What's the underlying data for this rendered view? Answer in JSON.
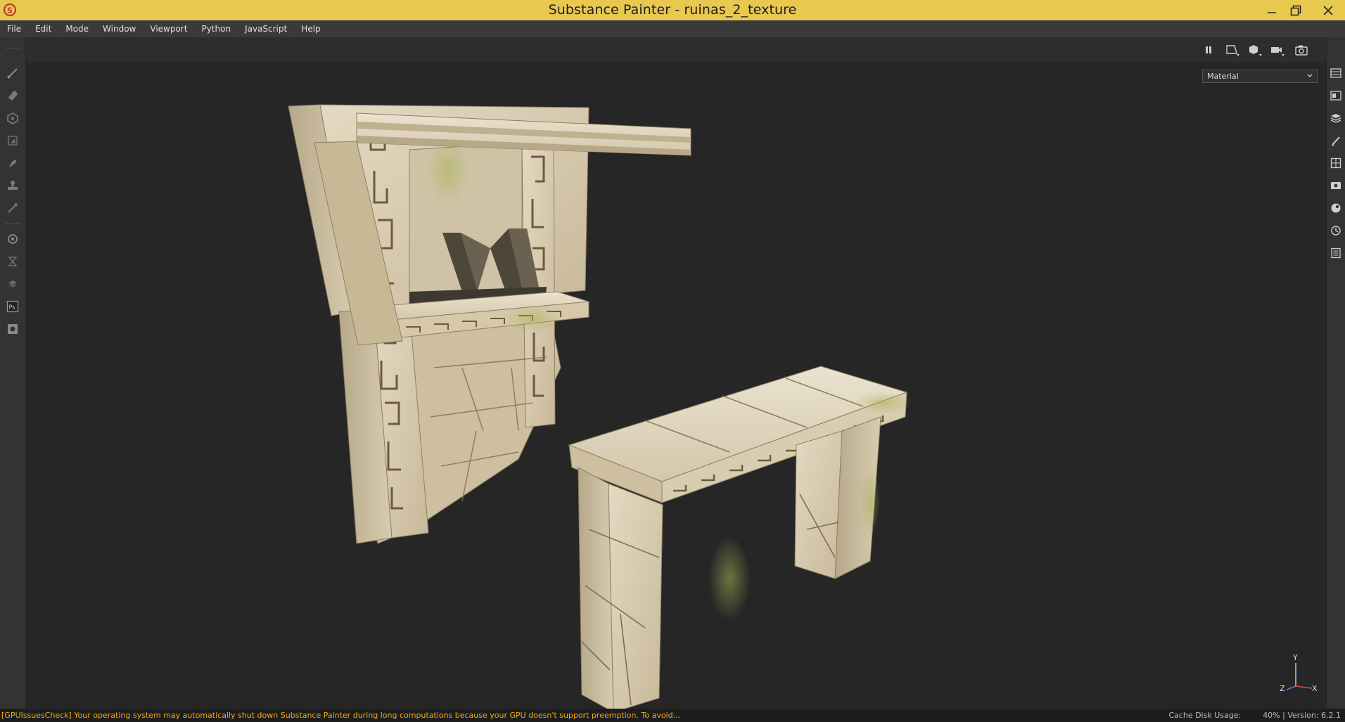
{
  "window": {
    "title": "Substance Painter - ruinas_2_texture",
    "accent_color": "#e9c850",
    "controls": [
      "minimize-icon",
      "restore-icon",
      "close-icon"
    ]
  },
  "menu": {
    "items": [
      "File",
      "Edit",
      "Mode",
      "Window",
      "Viewport",
      "Python",
      "JavaScript",
      "Help"
    ]
  },
  "left_toolbar": {
    "tools": [
      "paint-brush-icon",
      "eraser-icon",
      "projection-icon",
      "polygon-fill-icon",
      "smudge-icon",
      "clone-stamp-icon",
      "color-picker-icon",
      "bake-icon",
      "hourglass-icon",
      "layers-stack-icon",
      "photoshop-icon",
      "export-icon"
    ]
  },
  "right_strip": {
    "panels": [
      "layers-panel-icon",
      "texture-set-list-icon",
      "texture-set-settings-icon",
      "properties-icon",
      "shelf-icon",
      "display-settings-icon",
      "shader-settings-icon",
      "history-icon",
      "log-icon"
    ]
  },
  "viewport": {
    "toolbar": [
      "pause-icon",
      "2d-view-icon",
      "3d-view-icon",
      "camera-icon",
      "screenshot-icon"
    ],
    "channel_select": "Material",
    "axis_labels": {
      "x": "X",
      "y": "Y",
      "z": "Z"
    }
  },
  "status": {
    "message": "[GPUIssuesCheck] Your operating system may automatically shut down Substance Painter during long computations because your GPU doesn't support preemption. To avoid...",
    "message_color": "#f0a81e",
    "cache_label": "Cache Disk Usage:",
    "cache_value": "40%",
    "version": "Version: 6.2.1"
  }
}
